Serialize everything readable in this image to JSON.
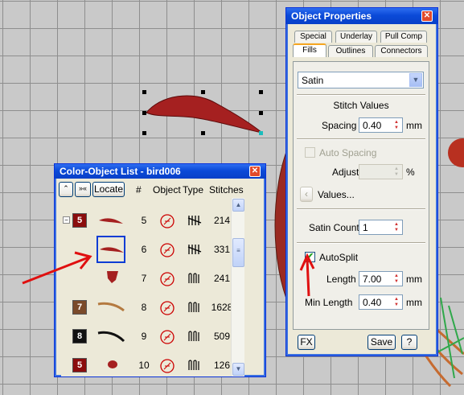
{
  "object_properties": {
    "title": "Object Properties",
    "tabs_top": [
      "Special",
      "Underlay",
      "Pull Comp"
    ],
    "tabs_bottom": [
      "Fills",
      "Outlines",
      "Connectors"
    ],
    "fill_type": "Satin",
    "section_title": "Stitch Values",
    "spacing_label": "Spacing",
    "spacing_value": "0.40",
    "spacing_unit": "mm",
    "auto_spacing_label": "Auto Spacing",
    "adjust_label": "Adjust",
    "adjust_unit": "%",
    "values_button": "Values...",
    "satin_count_label": "Satin Count",
    "satin_count_value": "1",
    "autosplit_label": "AutoSplit",
    "autosplit_checked": true,
    "length_label": "Length",
    "length_value": "7.00",
    "length_unit": "mm",
    "min_length_label": "Min Length",
    "min_length_value": "0.40",
    "min_length_unit": "mm",
    "fx_button": "FX",
    "save_button": "Save",
    "help_button": "?"
  },
  "color_object_list": {
    "title": "Color-Object List - bird006",
    "locate_button": "Locate",
    "columns": [
      "#",
      "Object",
      "Type",
      "Stitches"
    ],
    "rows": [
      {
        "color_num": "5",
        "swatch": "#8b0d0d",
        "num": "5",
        "stitches": "214",
        "shape": "feather-red",
        "type": "fill"
      },
      {
        "color_num": "",
        "swatch": "",
        "num": "6",
        "stitches": "331",
        "shape": "feather-red",
        "type": "fill",
        "selected": true
      },
      {
        "color_num": "",
        "swatch": "",
        "num": "7",
        "stitches": "241",
        "shape": "leaf-red",
        "type": "satin"
      },
      {
        "color_num": "7",
        "swatch": "#7a4a2a",
        "num": "8",
        "stitches": "1628",
        "shape": "branch-brown",
        "type": "satin"
      },
      {
        "color_num": "8",
        "swatch": "#111111",
        "num": "9",
        "stitches": "509",
        "shape": "branch-black",
        "type": "satin"
      },
      {
        "color_num": "5",
        "swatch": "#8b0d0d",
        "num": "10",
        "stitches": "126",
        "shape": "dot-red",
        "type": "satin"
      }
    ]
  }
}
